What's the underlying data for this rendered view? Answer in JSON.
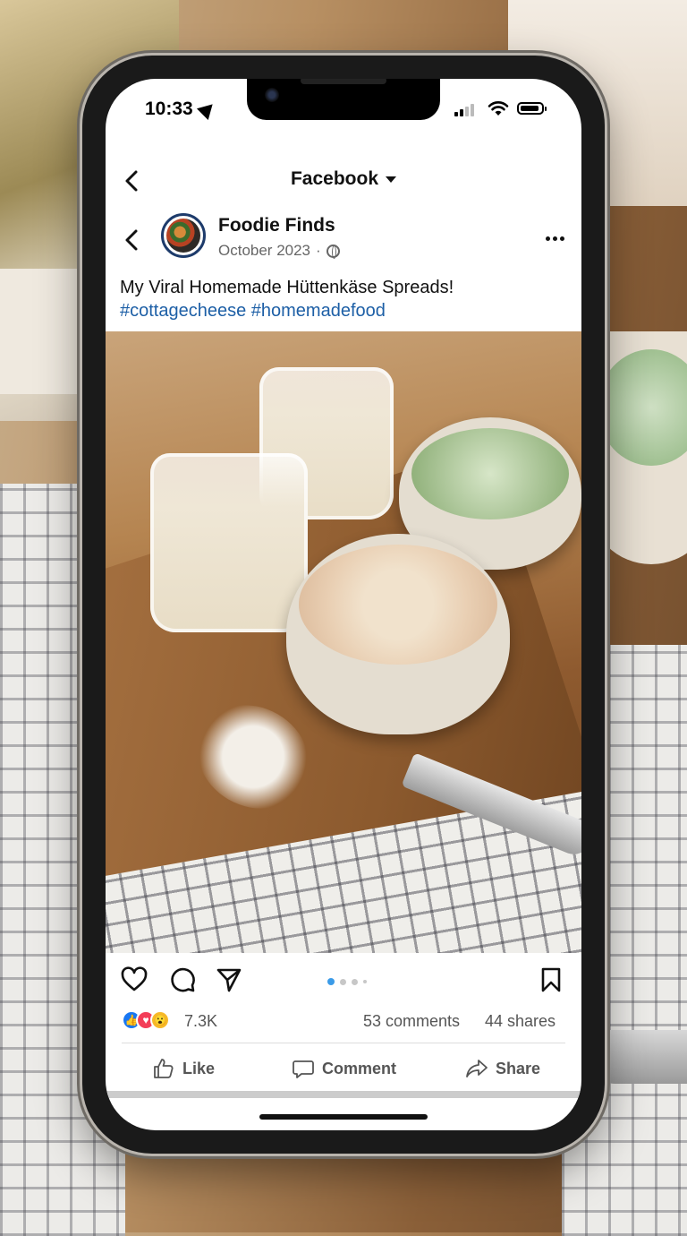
{
  "status_bar": {
    "time": "10:33"
  },
  "nav": {
    "title": "Facebook"
  },
  "post": {
    "author": "Foodie Finds",
    "date": "October 2023",
    "separator": "·",
    "caption": "My Viral Homemade Hüttenkäse Spreads!",
    "hashtags": "#cottagecheese #homemadefood"
  },
  "carousel": {
    "total": 4,
    "active": 1
  },
  "stats": {
    "reaction_count": "7.3K",
    "comments": "53 comments",
    "shares": "44 shares"
  },
  "buttons": {
    "like": "Like",
    "comment": "Comment",
    "share": "Share"
  },
  "colors": {
    "link": "#1d5fa6",
    "like_reaction": "#1877f2",
    "love_reaction": "#f33e58",
    "wow_reaction": "#f7b928"
  },
  "icons": {
    "heart": "heart-icon",
    "comment": "comment-bubble-icon",
    "send": "send-icon",
    "bookmark": "bookmark-icon",
    "thumbs_up": "thumbs-up-icon",
    "share_arrow": "share-arrow-icon",
    "globe": "globe-icon",
    "more": "more-dots-icon"
  }
}
